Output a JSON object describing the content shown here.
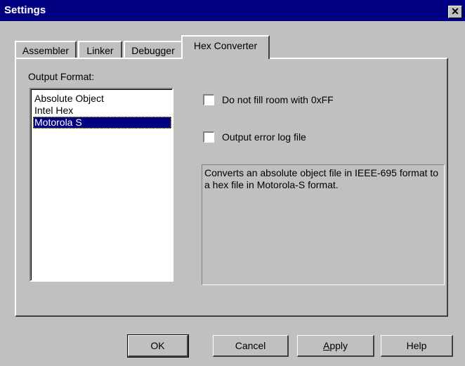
{
  "window": {
    "title": "Settings",
    "close_symbol": "✕"
  },
  "tabs": [
    {
      "label": "Assembler"
    },
    {
      "label": "Linker"
    },
    {
      "label": "Debugger"
    },
    {
      "label": "Hex Converter",
      "active": true
    }
  ],
  "output_format": {
    "label": "Output Format:",
    "options": [
      "Absolute Object",
      "Intel Hex",
      "Motorola S"
    ],
    "selected": "Motorola S"
  },
  "options": {
    "no_fill": {
      "label": "Do not fill room with 0xFF",
      "checked": false
    },
    "error_log": {
      "label": "Output error log file",
      "checked": false
    }
  },
  "description": "Converts an absolute object file in IEEE-695 format to a hex file in Motorola-S format.",
  "buttons": {
    "ok": "OK",
    "cancel": "Cancel",
    "apply_prefix": "A",
    "apply_rest": "pply",
    "help": "Help"
  }
}
